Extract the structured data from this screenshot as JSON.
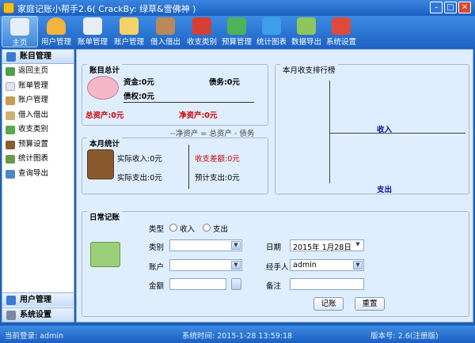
{
  "window": {
    "title": "家庭记账小帮手2.6( CrackBy: 绿草&雪佛神 )",
    "colors": {
      "titlebar": "#2a70d0",
      "close": "#d8472f"
    }
  },
  "toolbar": {
    "items": [
      {
        "label": "主页",
        "icon": "home-icon",
        "color": "#e8eef8"
      },
      {
        "label": "用户管理",
        "icon": "user-icon",
        "color": "#f3b33d"
      },
      {
        "label": "账单管理",
        "icon": "bill-icon",
        "color": "#e9edf3"
      },
      {
        "label": "账户管理",
        "icon": "account-icon",
        "color": "#f5d36a"
      },
      {
        "label": "借入借出",
        "icon": "borrow-icon",
        "color": "#b9895b"
      },
      {
        "label": "收支类别",
        "icon": "basket-icon",
        "color": "#d64034"
      },
      {
        "label": "预算管理",
        "icon": "budget-icon",
        "color": "#4fb25a"
      },
      {
        "label": "统计图表",
        "icon": "chart-icon",
        "color": "#3aa0e8"
      },
      {
        "label": "数据导出",
        "icon": "export-icon",
        "color": "#8fc65c"
      },
      {
        "label": "系统设置",
        "icon": "settings-icon",
        "color": "#e04a3c"
      }
    ]
  },
  "sidebar": {
    "header": "账目管理",
    "items": [
      {
        "label": "返回主页",
        "icon": "back-icon",
        "color": "#4fa04a"
      },
      {
        "label": "账单管理",
        "icon": "bill-icon",
        "color": "#dfe6ee"
      },
      {
        "label": "账户管理",
        "icon": "account-icon",
        "color": "#c79b55"
      },
      {
        "label": "借入借出",
        "icon": "borrow-icon",
        "color": "#d0b070"
      },
      {
        "label": "收支类别",
        "icon": "category-icon",
        "color": "#5aa74c"
      },
      {
        "label": "预算设置",
        "icon": "budget-icon",
        "color": "#8a5a30"
      },
      {
        "label": "统计图表",
        "icon": "chart-icon",
        "color": "#6a9a4a"
      },
      {
        "label": "查询导出",
        "icon": "search-icon",
        "color": "#4b86c8"
      }
    ],
    "footer": [
      {
        "label": "用户管理",
        "icon": "user-icon",
        "color": "#3a7ad0"
      },
      {
        "label": "系统设置",
        "icon": "settings-icon",
        "color": "#7a8aa0"
      }
    ]
  },
  "summary": {
    "title": "账目总计",
    "assets": "资金:0元",
    "debt": "债务:0元",
    "claims": "债权:0元",
    "total_assets": "总资产:0元",
    "net_assets": "净资产:0元",
    "formula": "--净资产 = 总资产 - 债务"
  },
  "ranking": {
    "title": "本月收支排行榜",
    "income_label": "收入",
    "expense_label": "支出"
  },
  "monthly": {
    "title": "本月统计",
    "actual_income": "实际收入:0元",
    "actual_expense": "实际支出:0元",
    "balance": "收支差额:0元",
    "budget_expense": "预计支出:0元"
  },
  "daily": {
    "title": "日常记账",
    "type_label": "类型",
    "type_income": "收入",
    "type_expense": "支出",
    "category_label": "类别",
    "category_value": "",
    "date_label": "日期",
    "date_value": "2015年 1月28日",
    "account_label": "账户",
    "account_value": "",
    "handler_label": "经手人",
    "handler_value": "admin",
    "amount_label": "金额",
    "amount_value": "",
    "note_label": "备注",
    "note_value": "",
    "submit_label": "记账",
    "reset_label": "重置"
  },
  "status": {
    "login": "当前登录: admin",
    "time": "系统时间: 2015-1-28 13:59:18",
    "version": "版本号: 2.6(注册版)"
  }
}
